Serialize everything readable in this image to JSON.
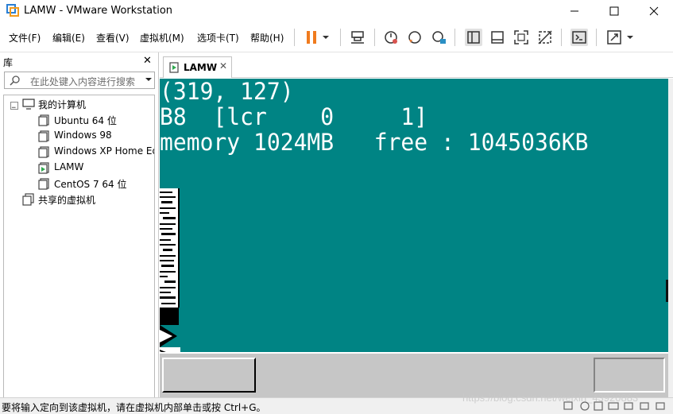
{
  "window": {
    "title": "LAMW - VMware Workstation"
  },
  "menu": {
    "file": "文件(F)",
    "edit": "编辑(E)",
    "view": "查看(V)",
    "vm": "虚拟机(M)",
    "tabs": "选项卡(T)",
    "help": "帮助(H)"
  },
  "library": {
    "title": "库",
    "search_placeholder": "在此处键入内容进行搜索",
    "tree": {
      "root": "我的计算机",
      "items": [
        "Ubuntu 64 位",
        "Windows 98",
        "Windows XP Home Ed",
        "LAMW",
        "CentOS 7 64 位"
      ],
      "shared": "共享的虚拟机"
    }
  },
  "tab": {
    "label": "LAMW"
  },
  "console": {
    "lines": [
      "(319, 127)",
      "B8  [lcr    0     1]",
      "memory 1024MB   free : 1045036KB"
    ]
  },
  "statusbar": {
    "text": "要将输入定向到该虚拟机，请在虚拟机内部单击或按 Ctrl+G。",
    "watermark": "https://blog.csdn.net/weixin_43920883"
  },
  "colors": {
    "vm_background": "#008484",
    "pause_icon": "#f07b1e",
    "taskbar": "#c6c6c6"
  },
  "icons": [
    "vmware-icon",
    "pause-icon",
    "send-keys-icon",
    "snapshot-icon",
    "revert-snapshot-icon",
    "snapshot-manager-icon",
    "library-view-icon",
    "thumbnail-view-icon",
    "fullscreen-icon",
    "unity-icon",
    "console-icon",
    "stretch-icon"
  ]
}
